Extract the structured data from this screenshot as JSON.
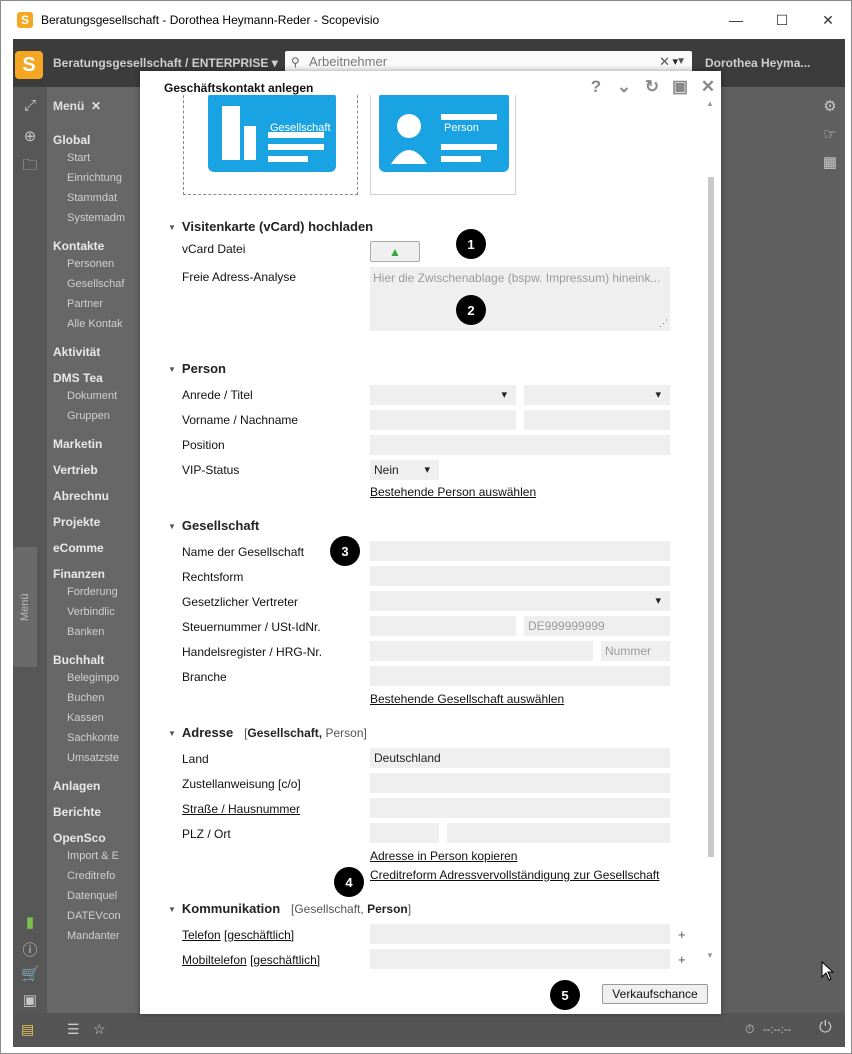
{
  "window": {
    "title": "Beratungsgesellschaft - Dorothea Heymann-Reder - Scopevisio",
    "app_icon": "S",
    "minimize": "—",
    "maximize": "☐",
    "close": "✕"
  },
  "topbar": {
    "logo": "S",
    "company": "Beratungsgesellschaft / ENTERPRISE ▾",
    "search_placeholder": "Arbeitnehmer",
    "user": "Dorothea Heyma..."
  },
  "menu": {
    "title": "Menü",
    "close": "✕",
    "tab_label": "Menü",
    "groups": [
      {
        "label": "Global",
        "items": [
          "Start",
          "Einrichtung",
          "Stammdat",
          "Systemadm"
        ]
      },
      {
        "label": "Kontakte",
        "items": [
          "Personen",
          "Gesellschaf",
          "Partner",
          "Alle Kontak"
        ]
      },
      {
        "label": "Aktivität",
        "items": []
      },
      {
        "label": "DMS Tea",
        "items": [
          "Dokument",
          "Gruppen"
        ]
      },
      {
        "label": "Marketin",
        "items": []
      },
      {
        "label": "Vertrieb",
        "items": []
      },
      {
        "label": "Abrechnu",
        "items": []
      },
      {
        "label": "Projekte",
        "items": []
      },
      {
        "label": "eComme",
        "items": []
      },
      {
        "label": "Finanzen",
        "items": [
          "Forderung",
          "Verbindlic",
          "Banken"
        ]
      },
      {
        "label": "Buchhalt",
        "items": [
          "Belegimpo",
          "Buchen",
          "Kassen",
          "Sachkonte",
          "Umsatzste"
        ]
      },
      {
        "label": "Anlagen",
        "items": []
      },
      {
        "label": "Berichte",
        "items": []
      },
      {
        "label": "OpenSco",
        "items": [
          "Import & E",
          "Creditrefo",
          "Datenquel",
          "DATEVcon",
          "Mandanter"
        ]
      }
    ]
  },
  "bottombar": {
    "timer": "--:--:--"
  },
  "dialog": {
    "title": "Geschäftskontakt anlegen",
    "tools": [
      "?",
      "⌄",
      "↻",
      "▣",
      "✕"
    ],
    "cards": {
      "company": "Gesellschaft",
      "person": "Person"
    },
    "vcard": {
      "section": "Visitenkarte (vCard) hochladen",
      "file_label": "vCard Datei",
      "analysis_label": "Freie Adress-Analyse",
      "analysis_placeholder": "Hier die Zwischenablage (bspw. Impressum) hineink..."
    },
    "person": {
      "section": "Person",
      "salutation_label": "Anrede / Titel",
      "name_label": "Vorname / Nachname",
      "position_label": "Position",
      "vip_label": "VIP-Status",
      "vip_value": "Nein",
      "select_existing": "Bestehende Person auswählen"
    },
    "company": {
      "section": "Gesellschaft",
      "name_label": "Name der Gesellschaft",
      "legal_form_label": "Rechtsform",
      "representative_label": "Gesetzlicher Vertreter",
      "tax_label": "Steuernummer / USt-IdNr.",
      "vat_placeholder": "DE999999999",
      "register_label": "Handelsregister / HRG-Nr.",
      "register_placeholder": "Nummer",
      "industry_label": "Branche",
      "select_existing": "Bestehende Gesellschaft auswählen"
    },
    "address": {
      "section": "Adresse",
      "scope_company": "Gesellschaft,",
      "scope_person": "Person",
      "country_label": "Land",
      "country_value": "Deutschland",
      "delivery_label": "Zustellanweisung [c/o]",
      "street_label": "Straße / Hausnummer",
      "zip_label": "PLZ / Ort",
      "copy_link": "Adresse in Person kopieren",
      "creditreform_link": "Creditreform Adressvervollständigung zur Gesellschaft"
    },
    "communication": {
      "section": "Kommunikation",
      "scope_company": "Gesellschaft,",
      "scope_person": "Person",
      "phone_label": "Telefon",
      "phone_type": "[geschäftlich]",
      "mobile_label": "Mobiltelefon",
      "mobile_type": "[geschäftlich]",
      "plus": "+"
    },
    "footer_button": "Verkaufschance"
  },
  "markers": [
    "1",
    "2",
    "3",
    "4",
    "5"
  ],
  "colors": {
    "card_blue": "#1aa3e3",
    "overlay": "#5f5f5f",
    "accent": "#f5a623"
  }
}
